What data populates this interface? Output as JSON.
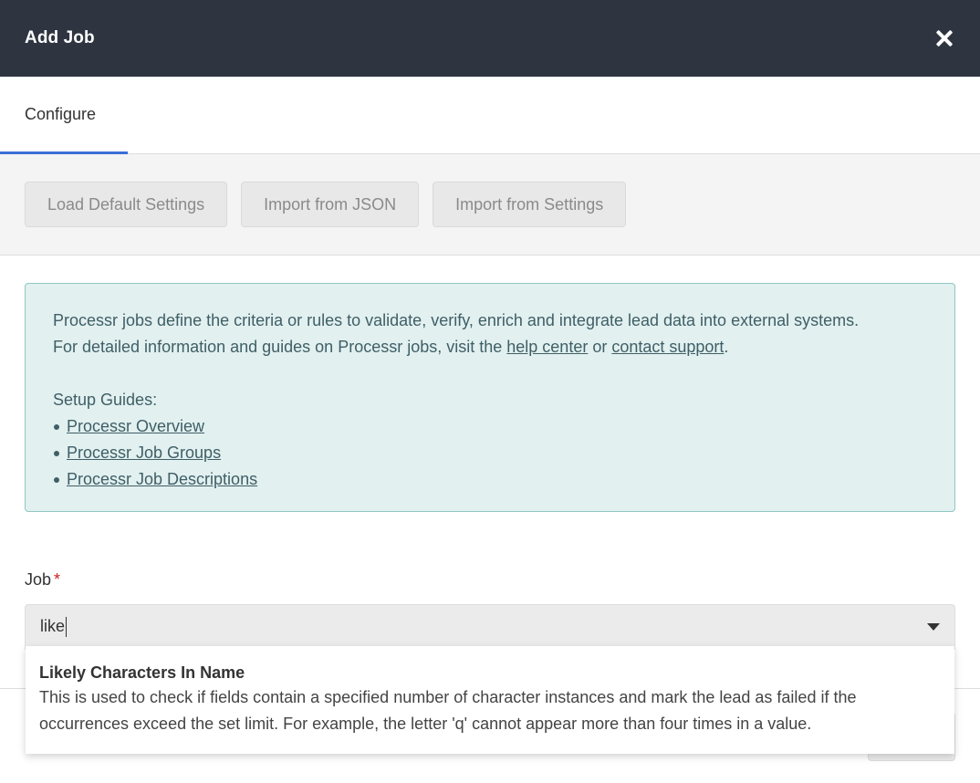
{
  "header": {
    "title": "Add Job"
  },
  "tabs": [
    {
      "label": "Configure",
      "active": true
    }
  ],
  "toolbar": {
    "load_default": "Load Default Settings",
    "import_json": "Import from JSON",
    "import_settings": "Import from Settings"
  },
  "info": {
    "line1": "Processr jobs define the criteria or rules to validate, verify, enrich and integrate lead data into external systems.",
    "line2_prefix": "For detailed information and guides on Processr jobs, visit the ",
    "help_center": "help center",
    "or": " or ",
    "contact_support": "contact support",
    "period": ".",
    "setup_guides": "Setup Guides:",
    "guides": [
      "Processr Overview",
      "Processr Job Groups",
      "Processr Job Descriptions"
    ]
  },
  "job_field": {
    "label": "Job",
    "required_mark": "*",
    "value": "like"
  },
  "dropdown": {
    "options": [
      {
        "title": "Likely Characters In Name",
        "description_line1": "This is used to check if fields contain a specified number of character instances and mark the lead as failed if the",
        "description_line2": "occurrences exceed the set limit. For example, the letter 'q' cannot appear more than four times in a value."
      }
    ]
  },
  "colors": {
    "header_bg": "#2e3440",
    "tab_accent": "#3b6fd8",
    "info_bg": "#e2f0f0",
    "info_border": "#8fc7c4",
    "required": "#cc2222"
  },
  "icons": {
    "close": "close-icon",
    "dropdown": "chevron-down-icon"
  }
}
